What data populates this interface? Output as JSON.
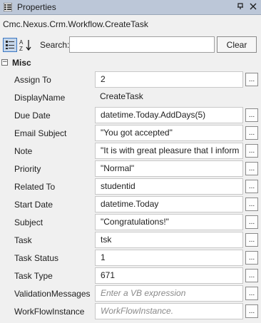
{
  "window": {
    "title": "Properties",
    "icons": {
      "window": "properties-grid-icon",
      "pin": "pin-icon",
      "close": "close-icon"
    }
  },
  "type_name": "Cmc.Nexus.Crm.Workflow.CreateTask",
  "toolbar": {
    "categorized_icon": "categorized-view-icon",
    "alphabetical_icon": "sort-alphabetical-icon",
    "search_label": "Search:",
    "search_value": "",
    "clear_label": "Clear"
  },
  "category": {
    "name": "Misc",
    "toggle": "⊟",
    "expanded": true
  },
  "properties": [
    {
      "name": "Assign To",
      "value": "2",
      "style": "box",
      "has_button": true
    },
    {
      "name": "DisplayName",
      "value": "CreateTask",
      "style": "plain",
      "has_button": false
    },
    {
      "name": "Due Date",
      "value": "datetime.Today.AddDays(5)",
      "style": "box",
      "has_button": true
    },
    {
      "name": "Email Subject",
      "value": "\"You got accepted\"",
      "style": "box",
      "has_button": true
    },
    {
      "name": "Note",
      "value": "\"It is with great pleasure that I inform",
      "style": "box",
      "has_button": true
    },
    {
      "name": "Priority",
      "value": "\"Normal\"",
      "style": "box",
      "has_button": true
    },
    {
      "name": "Related To",
      "value": "studentid",
      "style": "box",
      "has_button": true
    },
    {
      "name": "Start Date",
      "value": "datetime.Today",
      "style": "box",
      "has_button": true
    },
    {
      "name": "Subject",
      "value": "\"Congratulations!\"",
      "style": "box",
      "has_button": true
    },
    {
      "name": "Task",
      "value": "tsk",
      "style": "box",
      "has_button": true
    },
    {
      "name": "Task Status",
      "value": "1",
      "style": "box",
      "has_button": true
    },
    {
      "name": "Task Type",
      "value": "671",
      "style": "box",
      "has_button": true
    },
    {
      "name": "ValidationMessages",
      "value": "Enter a VB expression",
      "style": "placeholder",
      "has_button": true
    },
    {
      "name": "WorkFlowInstance",
      "value": "WorkFlowInstance.",
      "style": "placeholder",
      "has_button": true
    }
  ],
  "ellipsis_label": "..."
}
